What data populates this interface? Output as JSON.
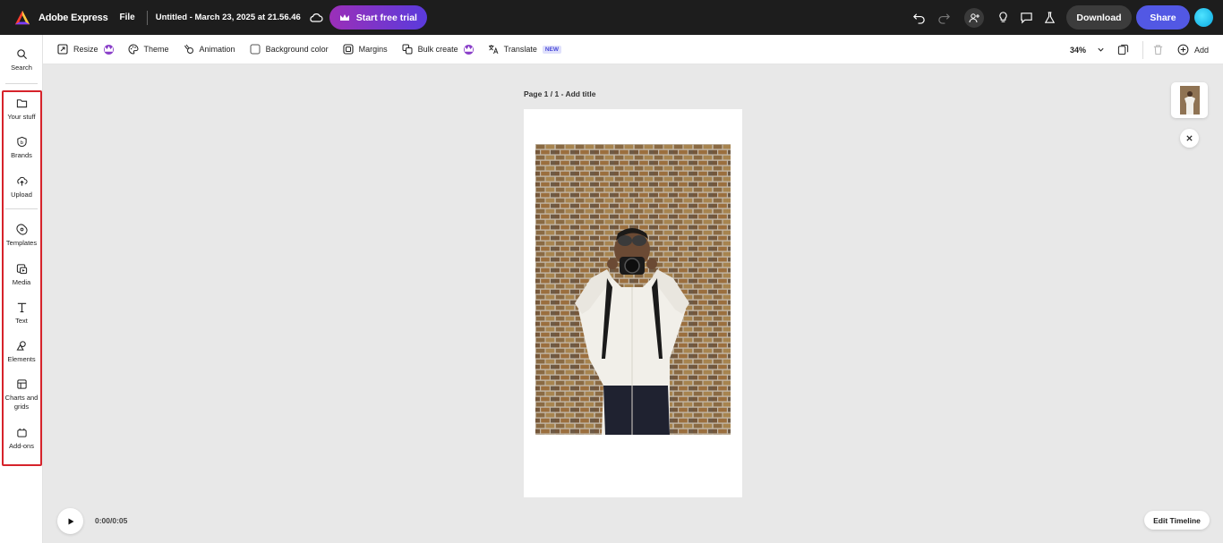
{
  "header": {
    "app_name": "Adobe Express",
    "file_menu": "File",
    "doc_title": "Untitled - March 23, 2025 at 21.56.46",
    "trial_label": "Start free trial",
    "download_label": "Download",
    "share_label": "Share"
  },
  "sidebar": {
    "items": [
      {
        "label": "Search",
        "icon": "search-icon"
      },
      {
        "label": "Your stuff",
        "icon": "folder-icon"
      },
      {
        "label": "Brands",
        "icon": "brand-icon"
      },
      {
        "label": "Upload",
        "icon": "upload-icon"
      },
      {
        "label": "Templates",
        "icon": "templates-icon"
      },
      {
        "label": "Media",
        "icon": "media-icon"
      },
      {
        "label": "Text",
        "icon": "text-icon"
      },
      {
        "label": "Elements",
        "icon": "elements-icon"
      },
      {
        "label": "Charts and grids",
        "icon": "charts-icon"
      },
      {
        "label": "Add-ons",
        "icon": "addons-icon"
      }
    ]
  },
  "toolbar": {
    "resize": "Resize",
    "theme": "Theme",
    "animation": "Animation",
    "background_color": "Background color",
    "margins": "Margins",
    "bulk_create": "Bulk create",
    "translate": "Translate",
    "new_badge": "NEW",
    "zoom": "34%",
    "add": "Add"
  },
  "canvas": {
    "page_label": "Page 1 / 1 - Add title"
  },
  "playback": {
    "time": "0:00/0:05",
    "edit_timeline": "Edit Timeline"
  },
  "colors": {
    "topbar": "#1d1d1d",
    "share": "#5258e4",
    "highlight": "#d6232b"
  }
}
